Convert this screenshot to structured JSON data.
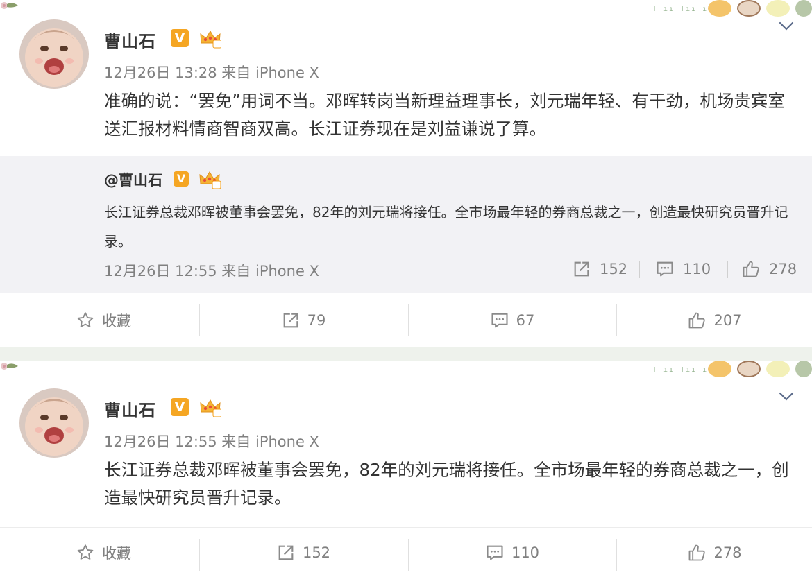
{
  "posts": [
    {
      "author": "曹山石",
      "verified_badge": "V",
      "level_badge": "5",
      "meta": "12月26日 13:28 来自 iPhone X",
      "text": "准确的说：“罢免”用词不当。邓晖转岗当新理益理事长，刘元瑞年轻、有干劲，机场贵宾室送汇报材料情商智商双高。长江证券现在是刘益谦说了算。",
      "repost": {
        "author": "@曹山石",
        "text": "长江证券总裁邓晖被董事会罢免，82年的刘元瑞将接任。全市场最年轻的券商总裁之一，创造最快研究员晋升记录。",
        "meta": "12月26日 12:55 来自 iPhone X",
        "reposts": "152",
        "comments": "110",
        "likes": "278"
      },
      "actions": {
        "favorite": "收藏",
        "reposts": "79",
        "comments": "67",
        "likes": "207"
      }
    },
    {
      "author": "曹山石",
      "verified_badge": "V",
      "level_badge": "5",
      "meta": "12月26日 12:55 来自 iPhone X",
      "text": "长江证券总裁邓晖被董事会罢免，82年的刘元瑞将接任。全市场最年轻的券商总裁之一，创造最快研究员晋升记录。",
      "actions": {
        "favorite": "收藏",
        "reposts": "152",
        "comments": "110",
        "likes": "278"
      }
    }
  ],
  "icons": {
    "favorite": "star-outline-icon",
    "repost": "share-arrow-icon",
    "comment": "comment-bubble-icon",
    "like": "thumbs-up-icon",
    "expand": "chevron-down-icon"
  },
  "colors": {
    "accent_badge": "#f5a623",
    "meta_text": "#808080",
    "repost_bg": "#f2f2f5",
    "card_gap": "#eef2ec"
  }
}
